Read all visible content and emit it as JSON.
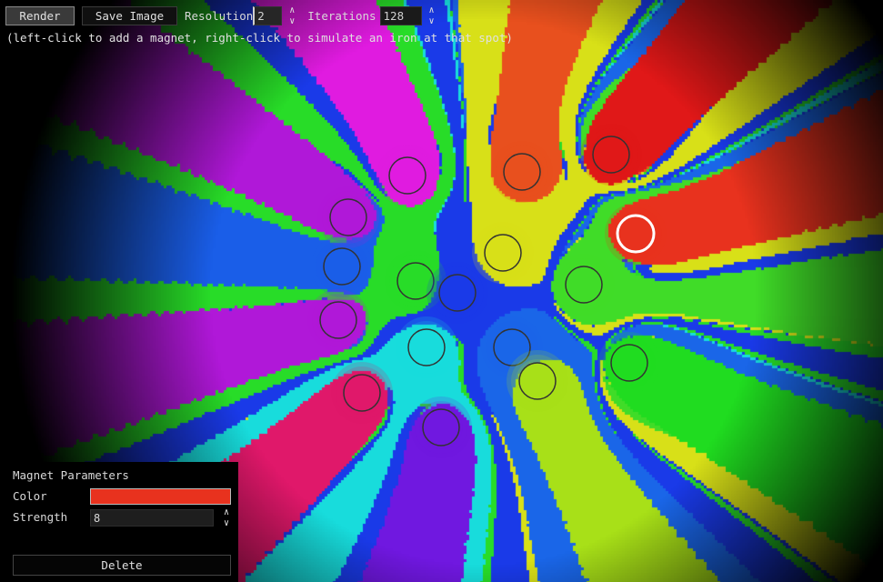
{
  "toolbar": {
    "render_label": "Render",
    "save_label": "Save Image",
    "resolution_label": "Resolution",
    "resolution_value": "2",
    "iterations_label": "Iterations",
    "iterations_value": "128"
  },
  "hint": "(left-click to add a magnet, right-click to simulate an iron at that spot)",
  "panel": {
    "title": "Magnet Parameters",
    "color_label": "Color",
    "color_value": "#e8321e",
    "strength_label": "Strength",
    "strength_value": "8",
    "delete_label": "Delete"
  },
  "magnets": [
    {
      "color": "#e01be0",
      "selected": false
    },
    {
      "color": "#e8501e",
      "selected": false
    },
    {
      "color": "#e01818",
      "selected": false
    },
    {
      "color": "#b018d8",
      "selected": false
    },
    {
      "color": "#e8321e",
      "selected": true
    },
    {
      "color": "#1a5ee8",
      "selected": false
    },
    {
      "color": "#d8e018",
      "selected": false
    },
    {
      "color": "#28dc28",
      "selected": false
    },
    {
      "color": "#1a3ae8",
      "selected": false
    },
    {
      "color": "#40dc28",
      "selected": false
    },
    {
      "color": "#b018d8",
      "selected": false
    },
    {
      "color": "#18dcdc",
      "selected": false
    },
    {
      "color": "#1a66e8",
      "selected": false
    },
    {
      "color": "#20dc20",
      "selected": false
    },
    {
      "color": "#e0186a",
      "selected": false
    },
    {
      "color": "#a8e018",
      "selected": false
    },
    {
      "color": "#7018e0",
      "selected": false
    }
  ]
}
